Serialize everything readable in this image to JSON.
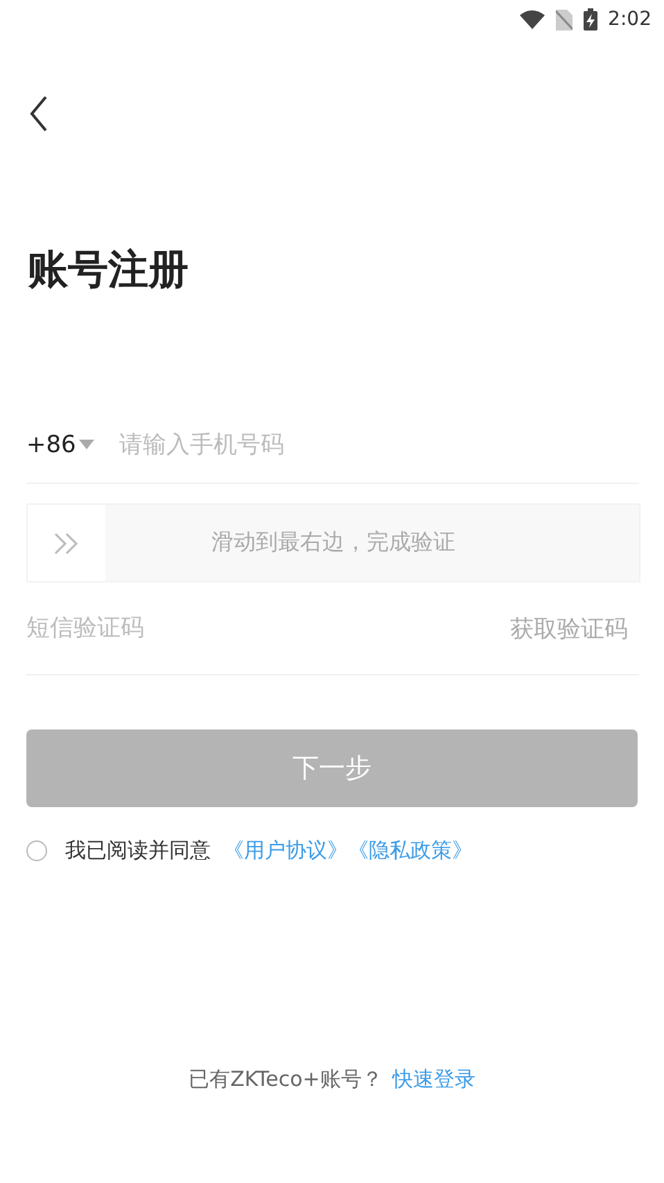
{
  "status_bar": {
    "time": "2:02"
  },
  "title": "账号注册",
  "phone": {
    "country_code": "+86",
    "placeholder": "请输入手机号码"
  },
  "slider": {
    "hint": "滑动到最右边，完成验证",
    "level": 0
  },
  "sms": {
    "placeholder": "短信验证码",
    "action": "获取验证码"
  },
  "next_button": {
    "label": "下一步",
    "disabled": true
  },
  "agreement": {
    "checked": false,
    "text": "我已阅读并同意",
    "links": [
      "《用户协议》",
      "《隐私政策》"
    ]
  },
  "footer": {
    "text": "已有ZKTeco+账号？",
    "link": "快速登录"
  }
}
